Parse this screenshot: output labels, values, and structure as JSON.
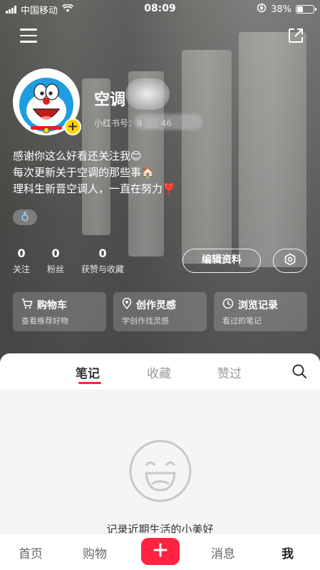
{
  "status_bar": {
    "carrier": "中国移动",
    "time": "08:09",
    "battery_percent": "38%",
    "battery_level": 0.38
  },
  "profile": {
    "username": "空调",
    "user_id_label": "小红书号：9",
    "user_id_suffix": "46",
    "bio": [
      "感谢你这么好看还关注我😊",
      "每次更新关于空调的那些事🏠",
      "理科生新晋空调人，一直在努力❣️"
    ],
    "gender_icon": "male-icon"
  },
  "stats": [
    {
      "num": "0",
      "label": "关注"
    },
    {
      "num": "0",
      "label": "粉丝"
    },
    {
      "num": "0",
      "label": "获赞与收藏"
    }
  ],
  "buttons": {
    "edit_profile": "编辑资料"
  },
  "cards": [
    {
      "title": "购物车",
      "subtitle": "查看推荐好物",
      "icon": "cart-icon"
    },
    {
      "title": "创作灵感",
      "subtitle": "学创作找灵感",
      "icon": "location-pin-icon"
    },
    {
      "title": "浏览记录",
      "subtitle": "看过的笔记",
      "icon": "clock-icon"
    }
  ],
  "tabs": [
    "笔记",
    "收藏",
    "赞过"
  ],
  "empty_state": {
    "text": "记录近期生活的小美好"
  },
  "bottom_nav": {
    "home": "首页",
    "shop": "购物",
    "messages": "消息",
    "me": "我"
  },
  "colors": {
    "accent": "#ff2442",
    "badge_yellow": "#ffd600"
  }
}
